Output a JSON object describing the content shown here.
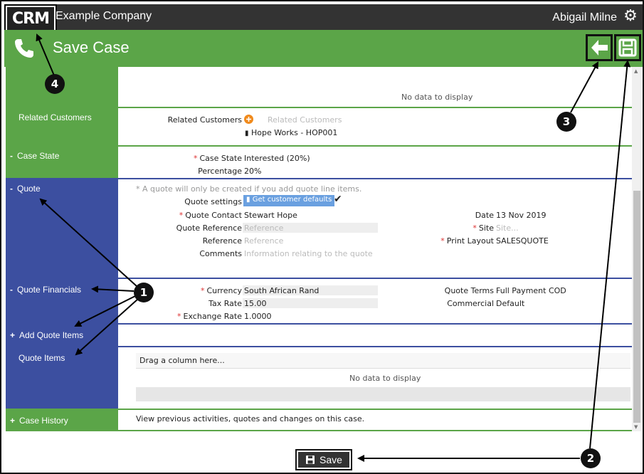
{
  "header": {
    "logo_text": "CRM",
    "company": "Example Company",
    "user": "Abigail Milne"
  },
  "titlebar": {
    "title": "Save Case"
  },
  "sections": {
    "top": {
      "no_data": "No data to display"
    },
    "related": {
      "label": "Related Customers",
      "field_label": "Related Customers",
      "placeholder": "Related Customers",
      "customer": "Hope Works - HOP001"
    },
    "case_state": {
      "label": "Case State",
      "sign": "-",
      "state_label": "Case State",
      "state_value": "Interested (20%)",
      "percentage_label": "Percentage",
      "percentage_value": "20%"
    },
    "quote": {
      "label": "Quote",
      "sign": "-",
      "note": "* A quote will only be created if you add quote line items.",
      "settings_label": "Quote settings",
      "settings_button": "Get customer defaults",
      "contact_label": "Quote Contact",
      "contact_value": "Stewart Hope",
      "quote_ref_label": "Quote Reference",
      "quote_ref_placeholder": "Reference",
      "ref_label": "Reference",
      "ref_placeholder": "Reference",
      "comments_label": "Comments",
      "comments_placeholder": "Information relating to the quote",
      "date_label": "Date",
      "date_value": "13 Nov 2019",
      "site_label": "Site",
      "site_placeholder": "Site...",
      "print_label": "Print Layout",
      "print_value": "SALESQUOTE"
    },
    "financials": {
      "label": "Quote Financials",
      "sign": "-",
      "currency_label": "Currency",
      "currency_value": "South African Rand",
      "tax_label": "Tax Rate",
      "tax_value": "15.00",
      "exchange_label": "Exchange Rate",
      "exchange_value": "1.0000",
      "terms_label": "Quote Terms",
      "terms_value": "Full Payment COD",
      "commercial_label": "Commercial",
      "commercial_value": "Default"
    },
    "add_items": {
      "label": "Add Quote Items",
      "sign": "+"
    },
    "items": {
      "label": "Quote Items",
      "drag_text": "Drag a column here...",
      "no_data": "No data to display"
    },
    "history": {
      "label": "Case History",
      "sign": "+",
      "text": "View previous activities, quotes and changes on this case."
    }
  },
  "footer": {
    "save_label": "Save"
  },
  "callouts": [
    "1",
    "2",
    "3",
    "4"
  ],
  "colors": {
    "green": "#5ba548",
    "blue": "#3c4fa0",
    "dark": "#333333"
  },
  "icons": [
    "gear-icon",
    "phone-icon",
    "back-arrow-icon",
    "floppy-disk-icon",
    "plus-circle-icon",
    "building-icon",
    "checkmark-icon"
  ]
}
